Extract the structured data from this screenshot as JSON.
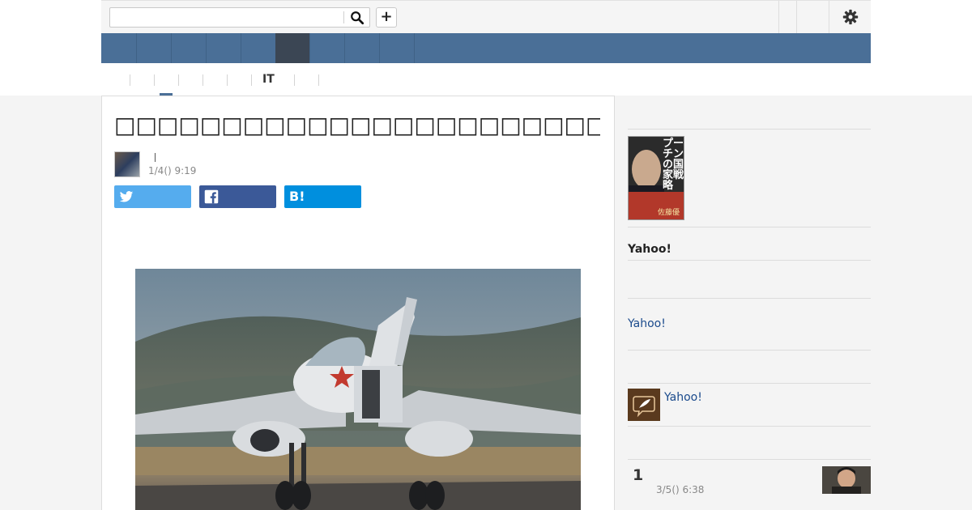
{
  "header": {
    "search": {
      "value": "",
      "placeholder": ""
    },
    "add_label": "+",
    "icons": {
      "search": "search-icon",
      "settings": "gear-icon"
    }
  },
  "nav": {
    "item_count": 9,
    "active_index": 5,
    "colors": {
      "bar": "#4a6f97",
      "active": "#3b4654"
    }
  },
  "category_tabs": {
    "visible_label": "IT",
    "active_index": 2
  },
  "article": {
    "title": "□□□□□□□□□□□□□□□□□□□□□□□□□□□□",
    "author_name": "",
    "date": "1/4() 9:19",
    "share": {
      "twitter": {
        "icon": "twitter-icon",
        "color": "#55acee"
      },
      "facebook": {
        "icon": "facebook-icon",
        "color": "#3b5998"
      },
      "hatena": {
        "label": "B!",
        "color": "#008fde"
      }
    }
  },
  "sidebar": {
    "book_cover_text": "プーチンの国家戦略",
    "book_cover_subtext": "佐藤優",
    "section_heading": "Yahoo!",
    "link_1": "Yahoo!",
    "link_2": "Yahoo!",
    "ranking": {
      "rank": "1",
      "date": "3/5() 6:38"
    }
  }
}
